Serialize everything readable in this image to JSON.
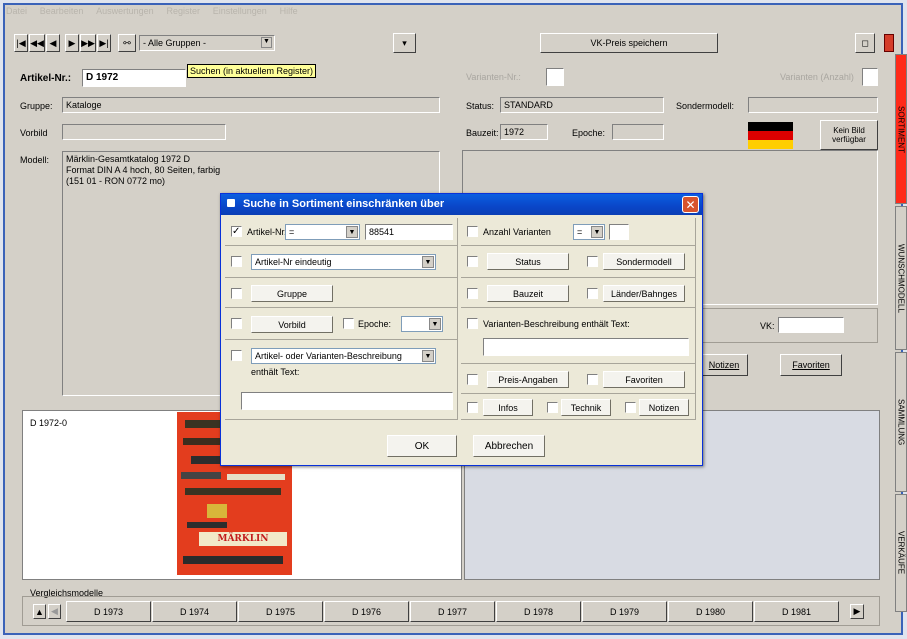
{
  "menu": [
    "Datei",
    "Bearbeiten",
    "Auswertungen",
    "Register",
    "Einstellungen",
    "Hilfe"
  ],
  "toolbar": {
    "group_filter": "- Alle Gruppen -",
    "vk_save": "VK-Preis speichern",
    "search_hint": "Suchen (in aktuellem Register)"
  },
  "form": {
    "artikel_label": "Artikel-Nr.:",
    "artikel_value": "D 1972",
    "gruppe_label": "Gruppe:",
    "gruppe_value": "Kataloge",
    "vorbild_label": "Vorbild",
    "modell_label": "Modell:",
    "modell_lines": [
      "Märklin-Gesamtkatalog 1972 D",
      "Format DIN A 4 hoch, 80 Seiten, farbig",
      "(151 01 - RON 0772 mo)"
    ],
    "varianten_label": "Varianten-Nr.:",
    "varianten_anzahl": "Varianten (Anzahl)",
    "status_label": "Status:",
    "status_value": "STANDARD",
    "sondermodell_label": "Sondermodell:",
    "bauzeit_label": "Bauzeit:",
    "bauzeit_value": "1972",
    "epoche_label": "Epoche:",
    "kein_bild": "Kein Bild verfügbar",
    "vk_label": "VK:",
    "notizen_btn": "Notizen",
    "favoriten_btn": "Favoriten",
    "image_label": "D 1972-0",
    "catalog_brand": "MÄRKLIN"
  },
  "side_tabs": [
    "SORTIMENT",
    "WUNSCHMODELL",
    "SAMMLUNG",
    "VERKÄUFE"
  ],
  "compare": {
    "label": "Vergleichsmodelle",
    "items": [
      "D 1973",
      "D 1974",
      "D 1975",
      "D 1976",
      "D 1977",
      "D 1978",
      "D 1979",
      "D 1980",
      "D 1981"
    ]
  },
  "dialog": {
    "title": "Suche in Sortiment einschränken über",
    "artikel_nr": "Artikel-Nr.",
    "artikel_op": "=",
    "artikel_value": "88541",
    "artikel_eindeutig": "Artikel-Nr eindeutig",
    "gruppe": "Gruppe",
    "vorbild": "Vorbild",
    "epoche": "Epoche:",
    "beschreibung_select": "Artikel- oder Varianten-Beschreibung",
    "enthaelt_text": "enthält Text:",
    "anzahl_varianten": "Anzahl Varianten",
    "anzahl_op": "=",
    "status": "Status",
    "sondermodell": "Sondermodell",
    "bauzeit": "Bauzeit",
    "laender": "Länder/Bahnges",
    "varianten_beschreibung": "Varianten-Beschreibung enthält Text:",
    "preis_angaben": "Preis-Angaben",
    "favoriten": "Favoriten",
    "infos": "Infos",
    "technik": "Technik",
    "notizen": "Notizen",
    "ok": "OK",
    "abbrechen": "Abbrechen"
  }
}
